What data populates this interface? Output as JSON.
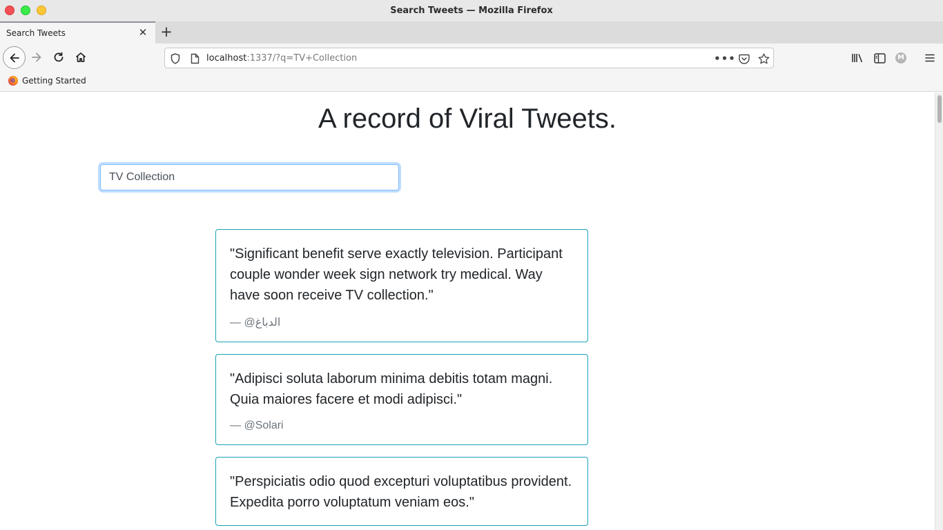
{
  "window": {
    "title": "Search Tweets — Mozilla Firefox"
  },
  "tabs": [
    {
      "label": "Search Tweets",
      "active": true
    }
  ],
  "urlbar": {
    "host": "localhost",
    "rest": ":1337/?q=TV+Collection"
  },
  "bookmarks": [
    {
      "label": "Getting Started",
      "icon": "firefox-icon"
    }
  ],
  "account": {
    "initial": "M"
  },
  "page": {
    "title": "A record of Viral Tweets.",
    "search_value": "TV Collection",
    "tweets": [
      {
        "text": "\"Significant benefit serve exactly television. Participant couple wonder week sign network try medical. Way have soon receive TV collection.\"",
        "author": "— @الدباغ"
      },
      {
        "text": "\"Adipisci soluta laborum minima debitis totam magni. Quia maiores facere et modi adipisci.\"",
        "author": "— @Solari"
      },
      {
        "text": "\"Perspiciatis odio quod excepturi voluptatibus provident. Expedita porro voluptatum veniam eos.\"",
        "author": ""
      }
    ]
  },
  "colors": {
    "card_border": "#17a2b8",
    "focus_border": "#80bdff",
    "muted_text": "#6c757d"
  }
}
